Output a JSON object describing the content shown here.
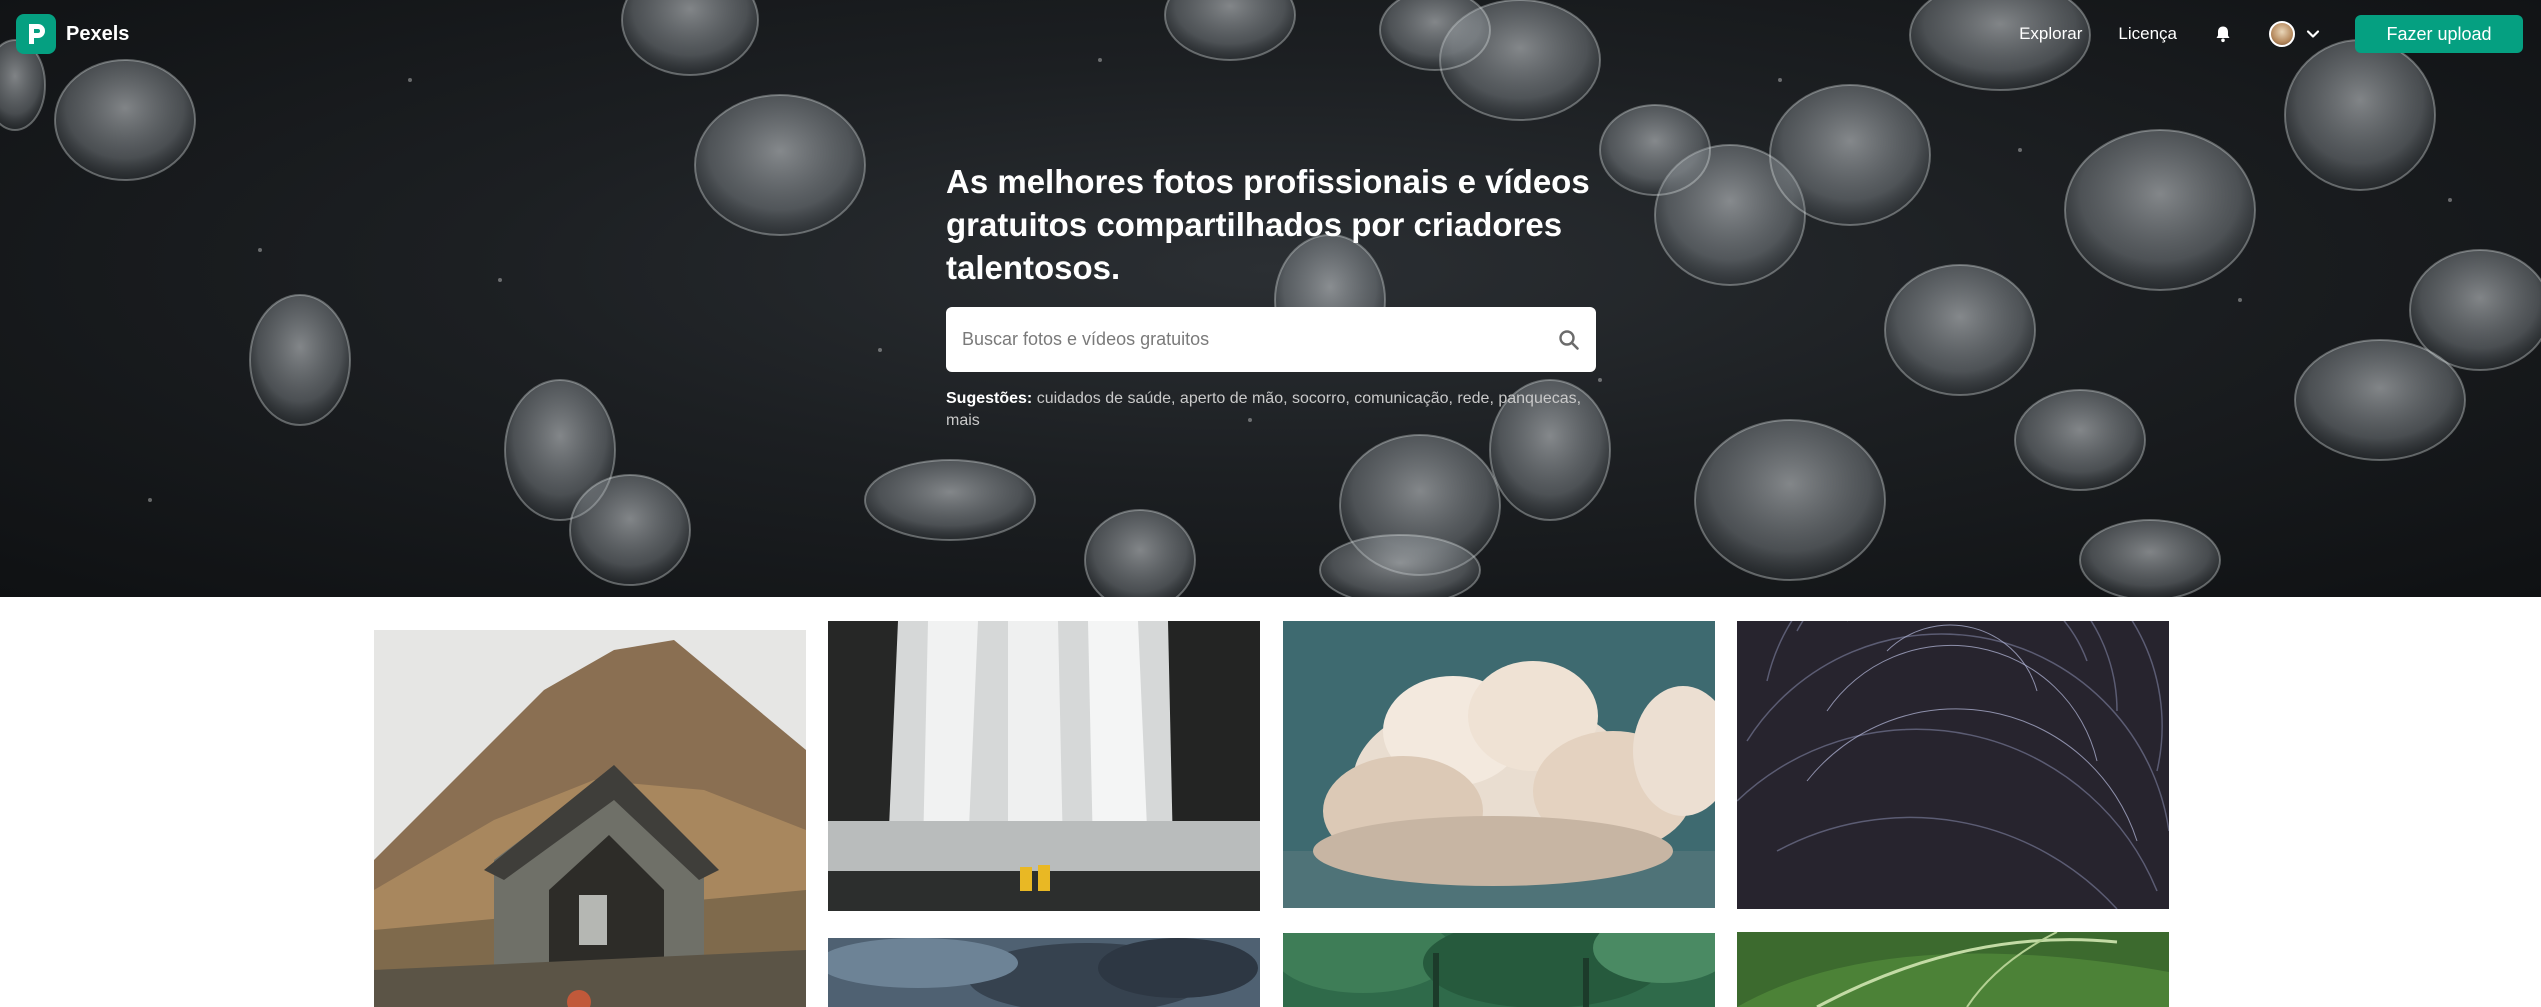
{
  "brand": {
    "name": "Pexels",
    "color": "#05a081"
  },
  "nav": {
    "explore": "Explorar",
    "license": "Licença",
    "notifications_icon": "bell-icon",
    "dropdown_icon": "chevron-down-icon",
    "upload": "Fazer upload"
  },
  "hero": {
    "headline": "As melhores fotos profissionais e vídeos gratuitos compartilhados por criadores talentosos.",
    "search": {
      "placeholder": "Buscar fotos e vídeos gratuitos",
      "icon": "search-icon"
    },
    "suggestions": {
      "label": "Sugestões:",
      "items": [
        "cuidados de saúde",
        "aperto de mão",
        "socorro",
        "comunicação",
        "rede",
        "panquecas"
      ],
      "more": "mais"
    }
  },
  "gallery": {
    "photos": [
      "mountain-cabin",
      "waterfall",
      "clouds",
      "star-trails",
      "cloudy-sky",
      "forest-canopy",
      "green-leaf"
    ]
  }
}
